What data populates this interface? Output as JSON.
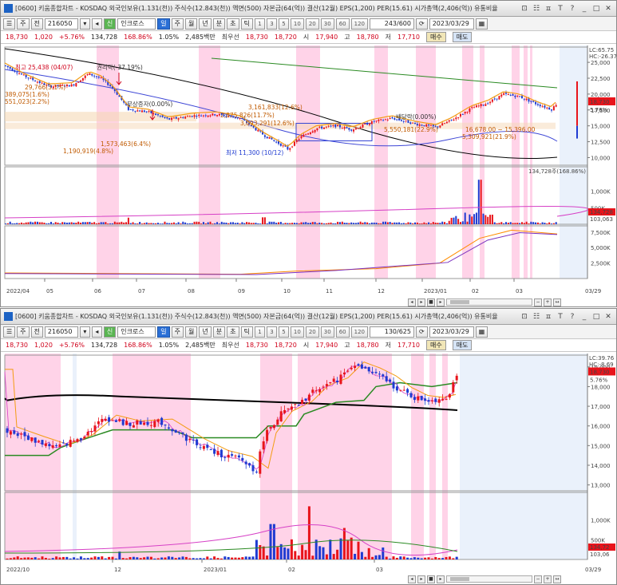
{
  "window_title": "[0600] 키움종합차트 - KOSDAQ 외국인보유(1.131(천)) 주식수(12.843(천)) 액면(500) 자본금(64(억)) 결산(12월) EPS(1,200) PER(15.61) 시가총액(2,406(억)) 유통비율",
  "toolbar": {
    "menu_label": "주",
    "jeon_label": "전",
    "stock_code": "216050",
    "credit_badge": "신",
    "stock_name": "인크로스",
    "period_buttons": [
      "일",
      "주",
      "월",
      "년",
      "분",
      "초",
      "틱"
    ],
    "active_period": "일",
    "minute_buttons": [
      "1",
      "3",
      "5",
      "10",
      "20",
      "30",
      "60",
      "120"
    ],
    "count_top": "243/600",
    "count_bottom": "130/625",
    "date": "2023/03/29"
  },
  "price": {
    "current": "18,730",
    "change": "1,020",
    "change_pct": "+5.76%",
    "volume": "134,728",
    "vol_ratio": "168.86%",
    "turnover": "1.05%",
    "amount": "2,485백만",
    "prior_label": "최우선",
    "bid1": "18,730",
    "bid2": "18,720",
    "open_label": "시",
    "open": "17,940",
    "high_label": "고",
    "high": "18,780",
    "low_label": "저",
    "low": "17,710",
    "buy_label": "매수",
    "sell_label": "매도"
  },
  "top_chart": {
    "lc_label": "LC:65.75",
    "hc_label": "HC:-26.37",
    "price_ticks": [
      "25,000",
      "22,500",
      "20,000",
      "17,500",
      "15,000",
      "12,500",
      "10,000"
    ],
    "cur_price_tag": "18,730",
    "cur_pct_tag": "5.76%",
    "volume_label": "134,728주(168.86%)",
    "vol_ticks": [
      "1,000K",
      "500K"
    ],
    "vol_tags": [
      "134,728",
      "103,063"
    ],
    "ind_ticks": [
      "7,500K",
      "5,000K",
      "2,500K"
    ],
    "x_labels": [
      "2022/04",
      "05",
      "06",
      "07",
      "08",
      "09",
      "10",
      "11",
      "12",
      "2023/01",
      "02",
      "03",
      "03/29"
    ],
    "annotations": {
      "high": "최고 25,438 (04/07)",
      "rights": "권리락(-37.19%)",
      "free_issue": "무상증자(0.00%)",
      "dividend": "배당락(0.00%)",
      "a1": "29,766(3.1%)",
      "a2": "389,075(1.6%)",
      "a3": "551,023(2.2%)",
      "a4": "3,161,833(12.6%)",
      "a5": "2,875,826(11.7%)",
      "a6": "3,093,291(12.6%)",
      "a7": "1,573,463(6.4%)",
      "a8": "1,190,919(4.8%)",
      "a9": "5,550,181(22.9%)",
      "a10": "16,678.00 ~ 15,396.00",
      "a11": "5,309,921(21.9%)",
      "low": "최저 11,300 (10/12)"
    }
  },
  "bottom_chart": {
    "lc_label": "LC:39.76",
    "hc_label": "HC:-8.69",
    "price_ticks": [
      "19,000",
      "18,000",
      "17,000",
      "16,000",
      "15,000",
      "14,000",
      "13,000"
    ],
    "cur_price_tag": "18,730",
    "cur_pct_tag": "5.76%",
    "vol_ticks": [
      "1,000K",
      "500K"
    ],
    "vol_tags": [
      "134,72",
      "103,06"
    ],
    "x_labels": [
      "2022/10",
      "12",
      "2023/01",
      "02",
      "03",
      "03/29"
    ]
  },
  "colors": {
    "up": "#e8141b",
    "down": "#1f3bd1",
    "band": "#ffd3e8",
    "band_pale": "#eaf1fb",
    "ma_long": "#000000",
    "ma_orange": "#f39c12",
    "ma_green": "#2a8a22",
    "ma_blue": "#3d46d6"
  }
}
